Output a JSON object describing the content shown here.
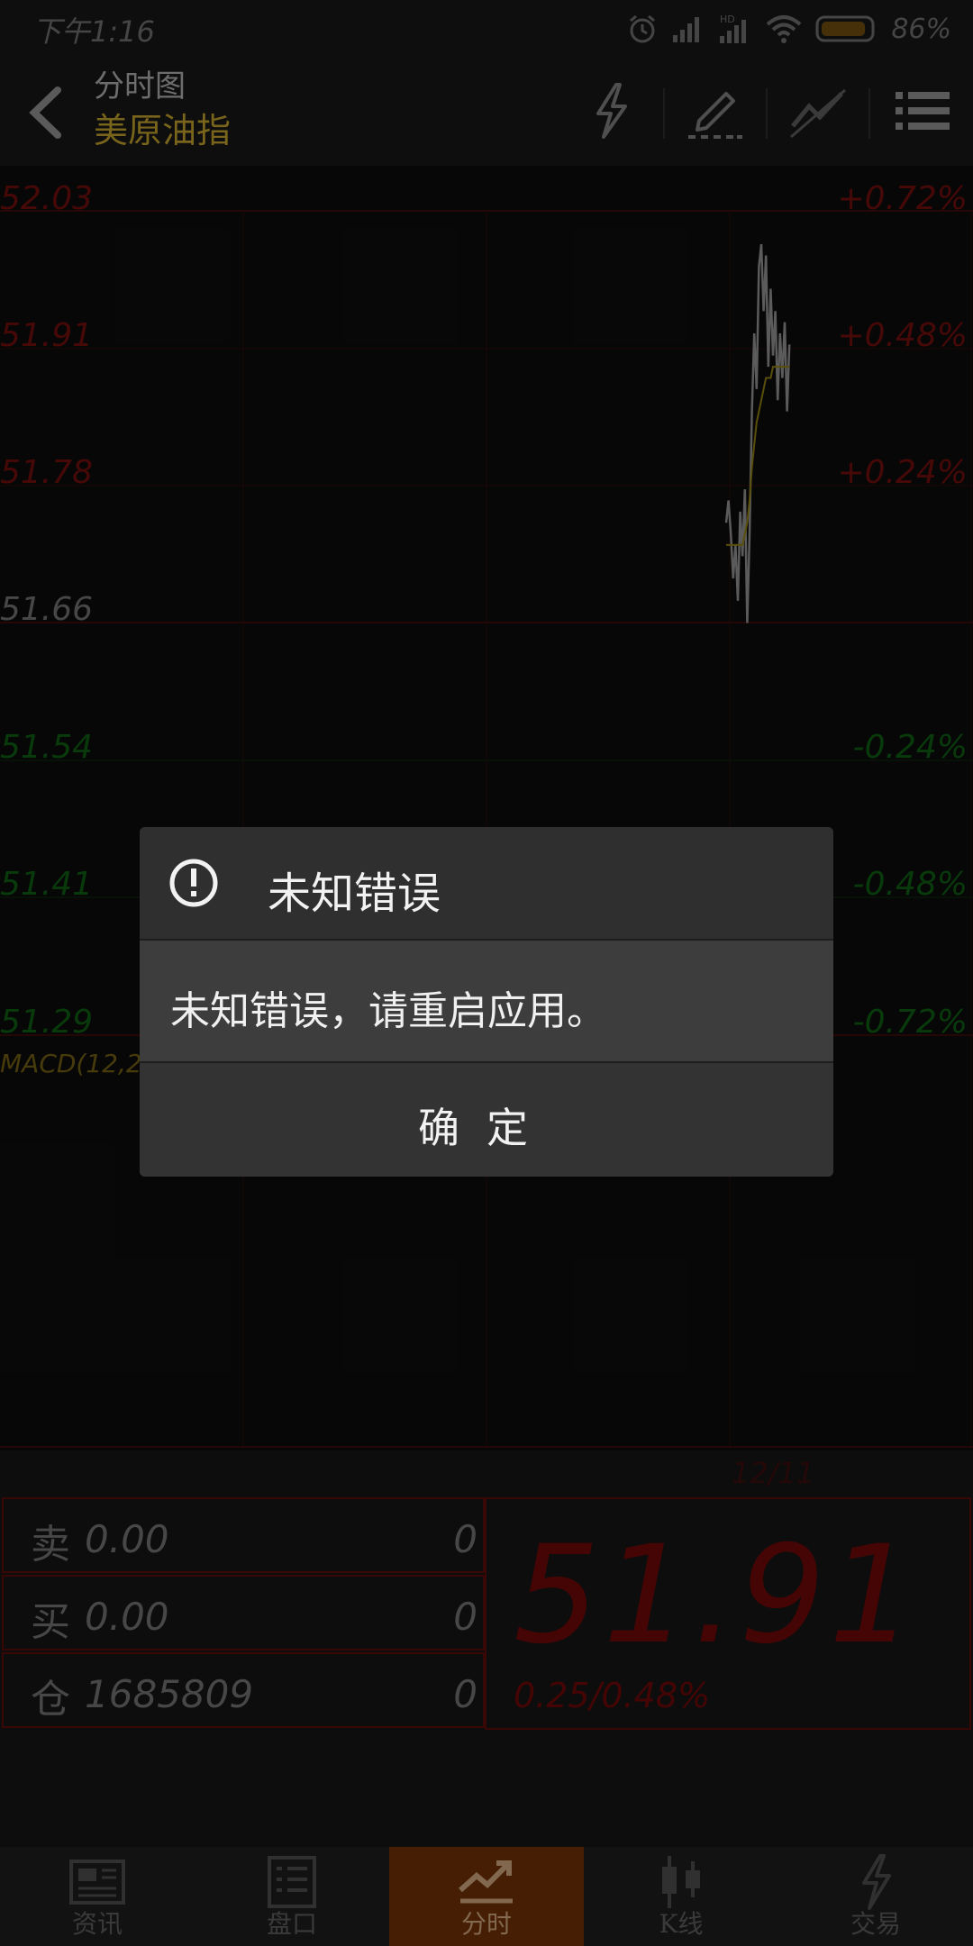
{
  "status_bar": {
    "time": "下午1:16",
    "battery_percent": "86%",
    "icons": [
      "alarm-icon",
      "signal-icon",
      "hd-signal-icon",
      "wifi-icon",
      "battery-icon"
    ]
  },
  "header": {
    "subtitle": "分时图",
    "title": "美原油指",
    "icons": [
      "back-icon",
      "lightning-icon",
      "pencil-icon",
      "line-tool-icon",
      "menu-icon"
    ]
  },
  "chart": {
    "y_labels_left": [
      "52.03",
      "51.91",
      "51.78",
      "51.66",
      "51.54",
      "51.41",
      "51.29"
    ],
    "y_labels_right": [
      "+0.72%",
      "+0.48%",
      "+0.24%",
      "-0.24%",
      "-0.48%",
      "-0.72%"
    ],
    "macd_label": "MACD(12,2",
    "date_label": "12/11",
    "colors": {
      "up": "#6e0d0d",
      "down": "#0d5a12",
      "neutral": "#6d6d6d",
      "avg_line": "#8a7a10",
      "price_line": "#8c8c8c"
    }
  },
  "chart_data": {
    "type": "line",
    "ylim": [
      51.29,
      52.03
    ],
    "y_ticks": [
      52.03,
      51.91,
      51.78,
      51.66,
      51.54,
      51.41,
      51.29
    ],
    "series": [
      {
        "values": [
          51.75,
          51.77,
          51.74,
          51.7,
          51.73,
          51.68,
          51.76,
          51.72,
          51.78,
          51.66,
          51.74,
          51.85,
          51.92,
          51.87,
          51.98,
          52.0,
          51.94,
          51.99,
          51.89,
          51.96,
          51.9,
          51.94,
          51.86,
          51.92,
          51.88,
          51.93,
          51.85,
          51.91
        ]
      },
      {
        "values": [
          51.73,
          51.73,
          51.73,
          51.73,
          51.73,
          51.73,
          51.73,
          51.73,
          51.74,
          51.75,
          51.77,
          51.8,
          51.82,
          51.84,
          51.85,
          51.86,
          51.87,
          51.88,
          51.88,
          51.88,
          51.89,
          51.89,
          51.89,
          51.89,
          51.89,
          51.89,
          51.89,
          51.89
        ]
      }
    ]
  },
  "quote": {
    "sell_label": "卖",
    "sell_value": "0.00",
    "sell_qty": "0",
    "buy_label": "买",
    "buy_value": "0.00",
    "buy_qty": "0",
    "oi_label": "仓",
    "oi_value": "1685809",
    "oi_qty": "0",
    "last_price": "51.91",
    "change": "0.25",
    "change_percent": "0.48%"
  },
  "tabs": [
    {
      "label": "资讯",
      "icon": "news-icon",
      "active": false
    },
    {
      "label": "盘口",
      "icon": "orderbook-icon",
      "active": false
    },
    {
      "label": "分时",
      "icon": "timeshare-icon",
      "active": true
    },
    {
      "label": "K线",
      "icon": "candlestick-icon",
      "active": false
    },
    {
      "label": "交易",
      "icon": "trade-icon",
      "active": false
    }
  ],
  "dialog": {
    "title": "未知错误",
    "message": "未知错误，请重启应用。",
    "confirm_label": "确定",
    "icon": "alert-icon"
  }
}
